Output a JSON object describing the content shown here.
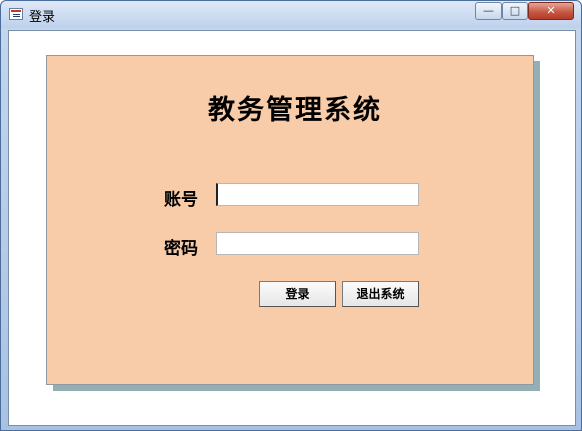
{
  "window": {
    "title": "登录",
    "controls": {
      "minimize": "—",
      "maximize": "□",
      "close": "✕"
    }
  },
  "form": {
    "system_title": "教务管理系统",
    "account_label": "账号",
    "account_value": "",
    "password_label": "密码",
    "password_value": "",
    "login_button": "登录",
    "exit_button": "退出系统"
  },
  "colors": {
    "panel_bg": "#f8cca8",
    "panel_shadow": "#93afb3",
    "close_button": "#c75a45"
  },
  "icons": [
    "app-form-icon",
    "minimize-icon",
    "maximize-icon",
    "close-icon"
  ]
}
